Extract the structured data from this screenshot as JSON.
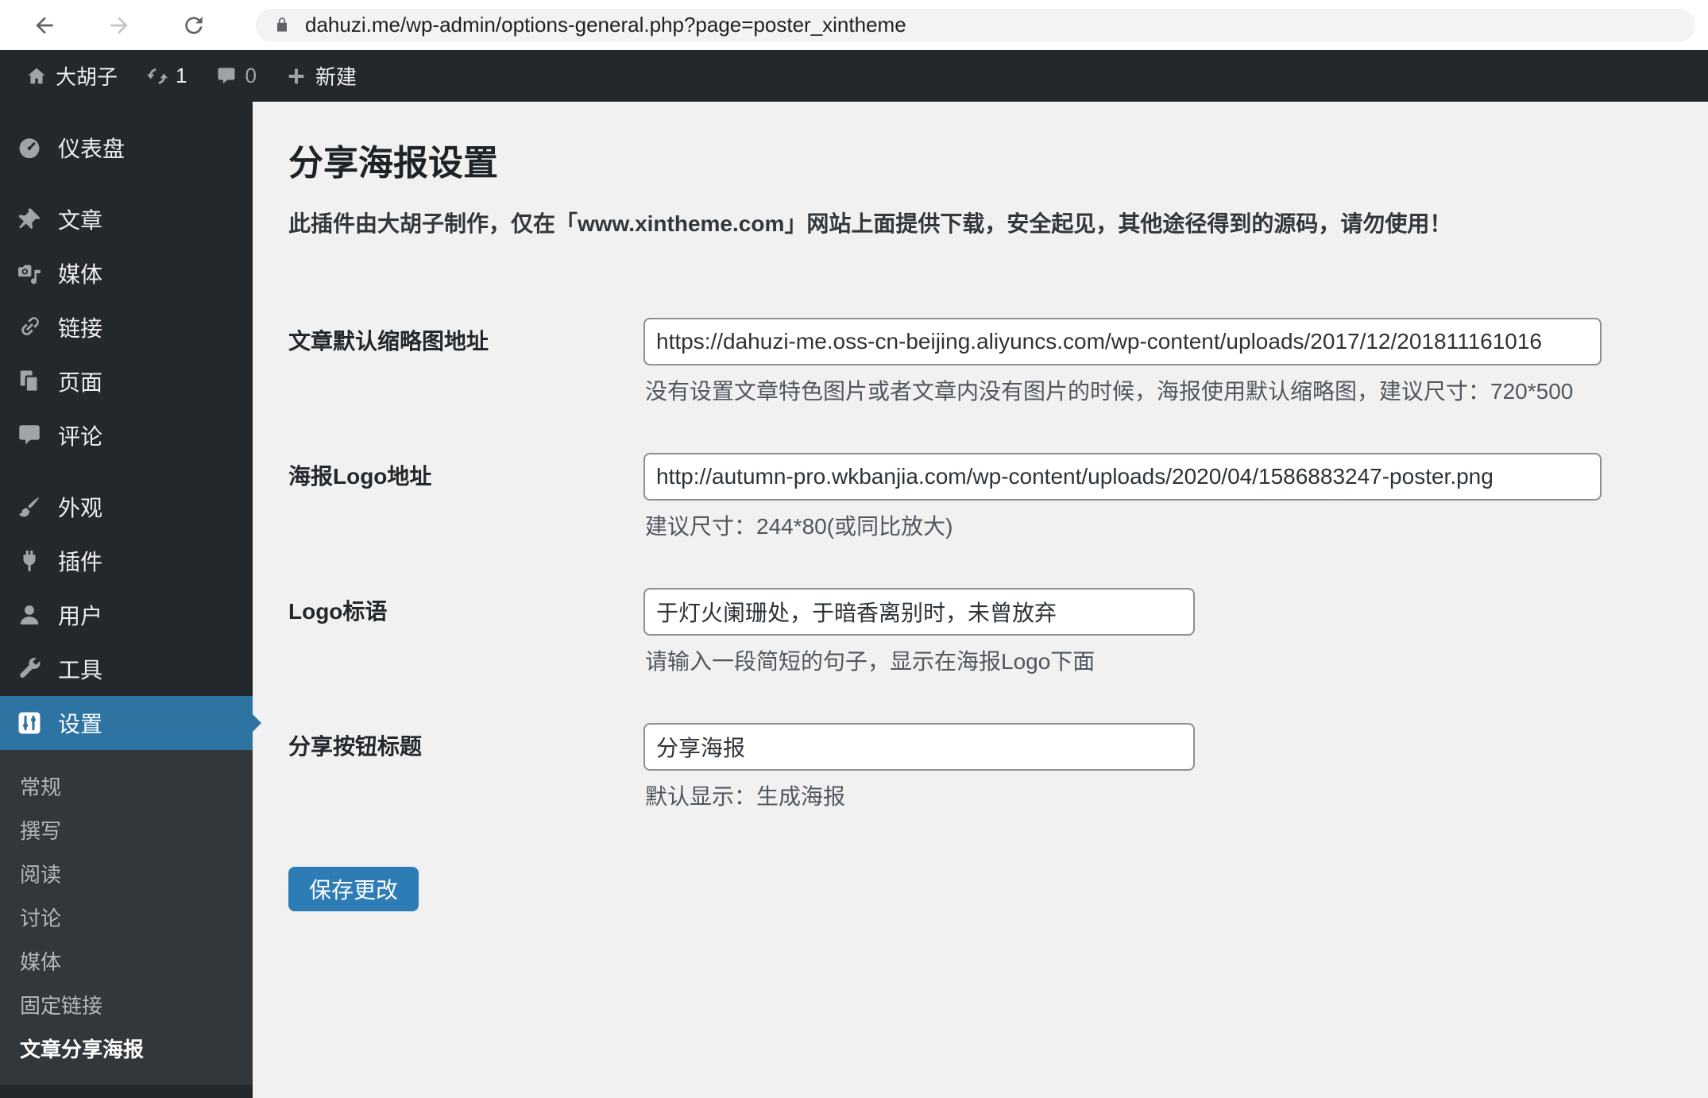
{
  "browser": {
    "url": "dahuzi.me/wp-admin/options-general.php?page=poster_xintheme"
  },
  "admin_bar": {
    "site_name": "大胡子",
    "update_count": "1",
    "comment_count": "0",
    "new_label": "新建"
  },
  "sidebar": {
    "items": [
      {
        "label": "仪表盘"
      },
      {
        "label": "文章"
      },
      {
        "label": "媒体"
      },
      {
        "label": "链接"
      },
      {
        "label": "页面"
      },
      {
        "label": "评论"
      },
      {
        "label": "外观"
      },
      {
        "label": "插件"
      },
      {
        "label": "用户"
      },
      {
        "label": "工具"
      },
      {
        "label": "设置"
      }
    ],
    "settings_submenu": [
      "常规",
      "撰写",
      "阅读",
      "讨论",
      "媒体",
      "固定链接",
      "文章分享海报"
    ]
  },
  "main": {
    "title": "分享海报设置",
    "description": "此插件由大胡子制作，仅在「www.xintheme.com」网站上面提供下载，安全起见，其他途径得到的源码，请勿使用！",
    "fields": [
      {
        "label": "文章默认缩略图地址",
        "value": "https://dahuzi-me.oss-cn-beijing.aliyuncs.com/wp-content/uploads/2017/12/201811161016",
        "help": "没有设置文章特色图片或者文章内没有图片的时候，海报使用默认缩略图，建议尺寸：720*500"
      },
      {
        "label": "海报Logo地址",
        "value": "http://autumn-pro.wkbanjia.com/wp-content/uploads/2020/04/1586883247-poster.png",
        "help": "建议尺寸：244*80(或同比放大)"
      },
      {
        "label": "Logo标语",
        "value": "于灯火阑珊处，于暗香离别时，未曾放弃",
        "help": "请输入一段简短的句子，显示在海报Logo下面"
      },
      {
        "label": "分享按钮标题",
        "value": "分享海报",
        "help": "默认显示：生成海报"
      }
    ],
    "save_label": "保存更改"
  },
  "colors": {
    "admin_dark": "#23282d",
    "submenu_dark": "#32373c",
    "active_menu_blue": "#2e74a3",
    "button_blue": "#2e7cb5",
    "content_bg": "#f1f1f1"
  }
}
